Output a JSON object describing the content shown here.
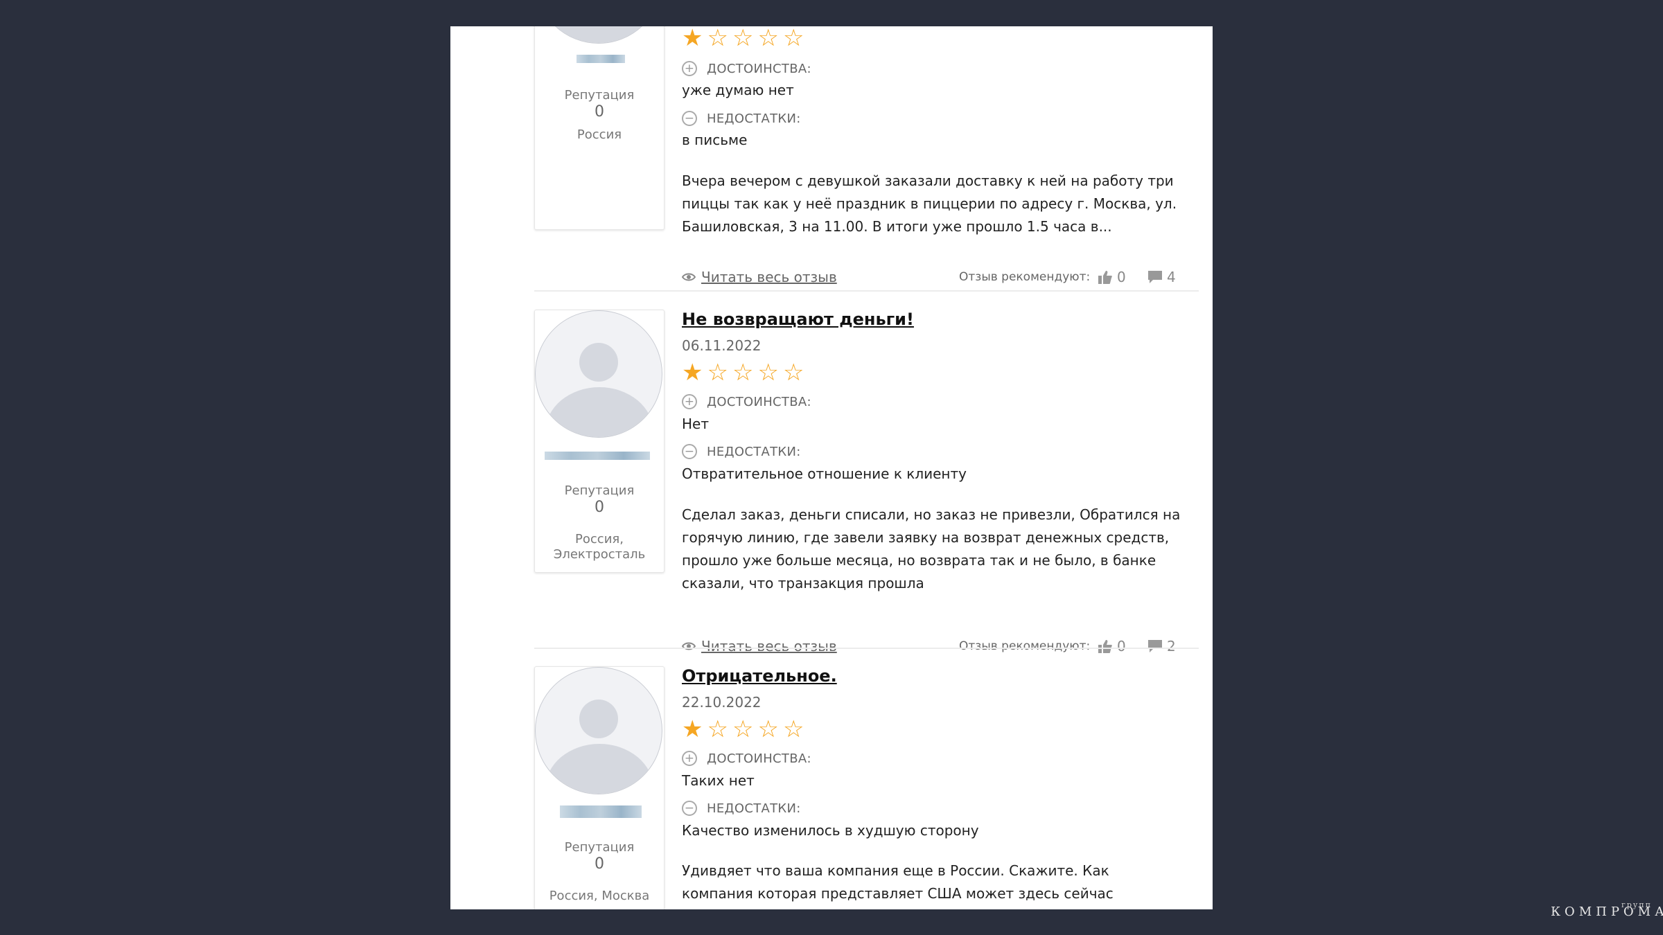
{
  "labels": {
    "pros": "ДОСТОИНСТВА:",
    "cons": "НЕДОСТАТКИ:",
    "reputation": "Репутация",
    "read_more": "Читать весь отзыв",
    "recommend": "Отзыв рекомендуют:"
  },
  "colors": {
    "star": "#f5a623",
    "background": "#2a2f3d"
  },
  "reviews": [
    {
      "title": "",
      "date": "",
      "rating": 1,
      "reputation": "0",
      "location": "Россия",
      "pros": "уже думаю нет",
      "cons": "в письме",
      "text": "Вчера вечером с девушкой заказали доставку к ней на работу три пиццы так как у неё праздник в пиццерии по адресу г. Москва, ул. Башиловская, 3 на 11.00. В итоги уже прошло 1.5 часа в...",
      "likes": "0",
      "comments": "4"
    },
    {
      "title": "Не возвращают деньги!",
      "date": "06.11.2022",
      "rating": 1,
      "reputation": "0",
      "location": "Россия, Электросталь",
      "pros": "Нет",
      "cons": "Отвратительное отношение к клиенту",
      "text": "Сделал заказ, деньги списали, но заказ не привезли, Обратился на горячую линию, где завели заявку на возврат денежных средств, прошло уже больше месяца, но возврата так и не было, в банке сказали, что транзакция прошла",
      "likes": "0",
      "comments": "2"
    },
    {
      "title": "Отрицательное.",
      "date": "22.10.2022",
      "rating": 1,
      "reputation": "0",
      "location": "Россия, Москва",
      "pros": "Таких нет",
      "cons": "Качество изменилось в худшую сторону",
      "text": "Удивдяет что ваша компания еще в России. Скажите. Как компания которая представляет США может здесь сейчас работать? Здесь в",
      "likes": "",
      "comments": ""
    }
  ],
  "watermark": {
    "main": "КОМПРОМАТ",
    "small": "групп"
  }
}
